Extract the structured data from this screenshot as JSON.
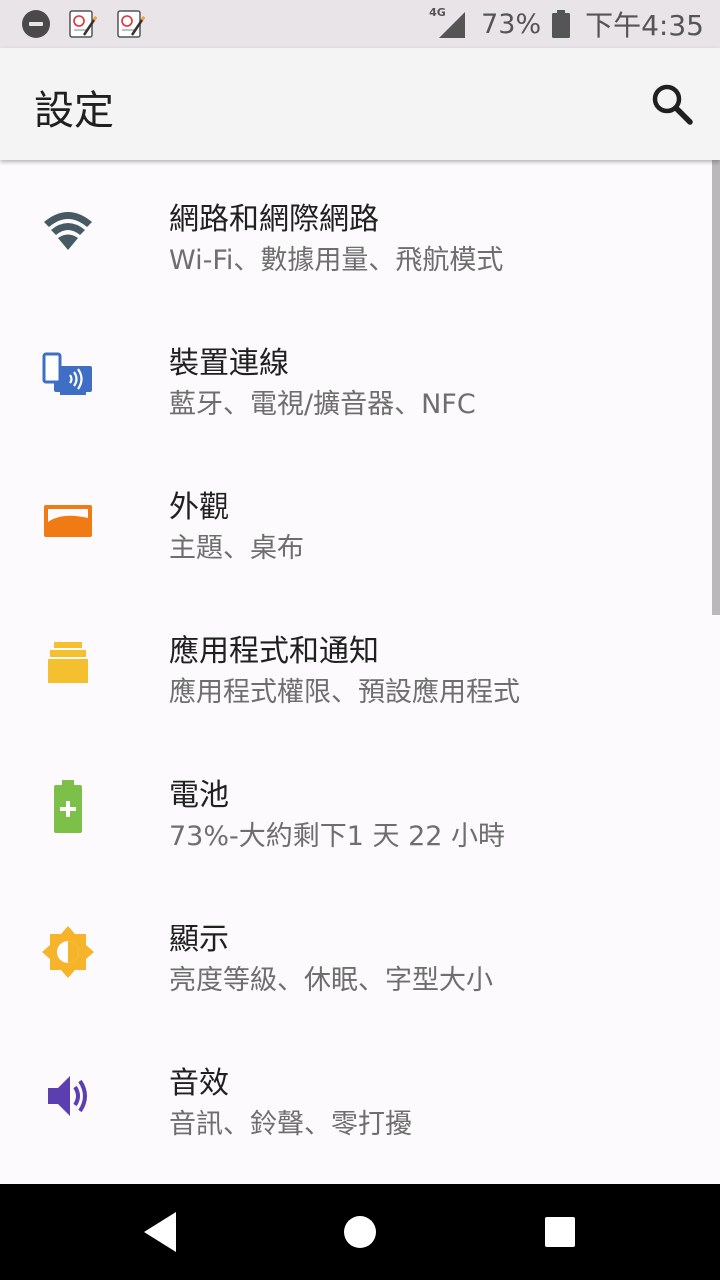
{
  "status_bar": {
    "network": "4G",
    "battery": "73%",
    "time": "下午4:35"
  },
  "app_bar": {
    "title": "設定",
    "search_icon": "search-icon"
  },
  "items": [
    {
      "title": "網路和網際網路",
      "subtitle": "Wi-Fi、數據用量、飛航模式",
      "icon": "wifi-icon",
      "color": "#455a64"
    },
    {
      "title": "裝置連線",
      "subtitle": "藍牙、電視/擴音器、NFC",
      "icon": "device-connection-icon",
      "color": "#3f6fc4"
    },
    {
      "title": "外觀",
      "subtitle": "主題、桌布",
      "icon": "appearance-icon",
      "color": "#f07a14"
    },
    {
      "title": "應用程式和通知",
      "subtitle": "應用程式權限、預設應用程式",
      "icon": "apps-icon",
      "color": "#f5c030"
    },
    {
      "title": "電池",
      "subtitle": "73%-大約剩下1 天 22 小時",
      "icon": "battery-icon",
      "color": "#7cc04a"
    },
    {
      "title": "顯示",
      "subtitle": "亮度等級、休眠、字型大小",
      "icon": "brightness-icon",
      "color": "#f5b42a"
    },
    {
      "title": "音效",
      "subtitle": "音訊、鈴聲、零打擾",
      "icon": "volume-icon",
      "color": "#5b3fb0"
    }
  ],
  "nav_bar": {
    "back_icon": "back-icon",
    "home_icon": "home-icon",
    "recents_icon": "recents-icon"
  }
}
